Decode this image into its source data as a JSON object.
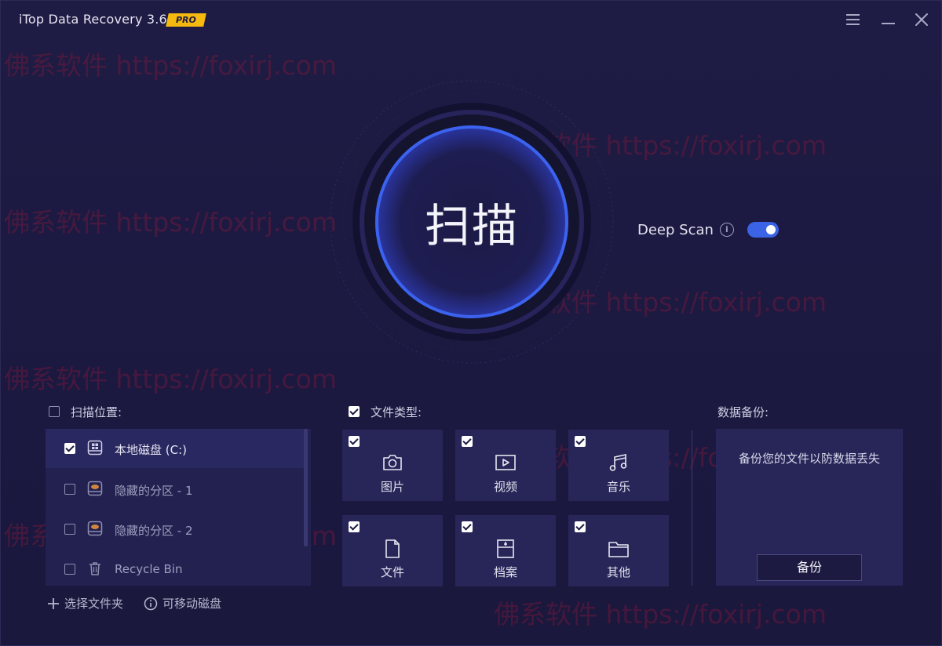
{
  "app": {
    "title": "iTop Data Recovery 3.6",
    "badge": "PRO",
    "window_controls": [
      "menu-icon",
      "minimize-icon",
      "close-icon"
    ]
  },
  "watermark": "佛系软件 https://foxirj.com",
  "scan": {
    "button_label": "扫描",
    "deep_scan_label": "Deep Scan",
    "deep_scan_enabled": true,
    "accent_color": "#3b63e6"
  },
  "scan_location": {
    "label": "扫描位置:",
    "checked": false,
    "items": [
      {
        "label": "本地磁盘 (C:)",
        "checked": true,
        "icon": "windows-drive-icon"
      },
      {
        "label": "隐藏的分区 - 1",
        "checked": false,
        "icon": "hidden-drive-icon"
      },
      {
        "label": "隐藏的分区 - 2",
        "checked": false,
        "icon": "hidden-drive-icon"
      },
      {
        "label": "Recycle Bin",
        "checked": false,
        "icon": "trash-icon"
      }
    ],
    "select_folder": "选择文件夹",
    "removable_disk": "可移动磁盘"
  },
  "file_types": {
    "label": "文件类型:",
    "checked": true,
    "items": [
      {
        "label": "图片",
        "checked": true,
        "icon": "camera-icon"
      },
      {
        "label": "视频",
        "checked": true,
        "icon": "video-icon"
      },
      {
        "label": "音乐",
        "checked": true,
        "icon": "music-icon"
      },
      {
        "label": "文件",
        "checked": true,
        "icon": "document-icon"
      },
      {
        "label": "档案",
        "checked": true,
        "icon": "archive-icon"
      },
      {
        "label": "其他",
        "checked": true,
        "icon": "folder-icon"
      }
    ]
  },
  "backup": {
    "label": "数据备份:",
    "description": "备份您的文件以防数据丢失",
    "button_label": "备份"
  }
}
